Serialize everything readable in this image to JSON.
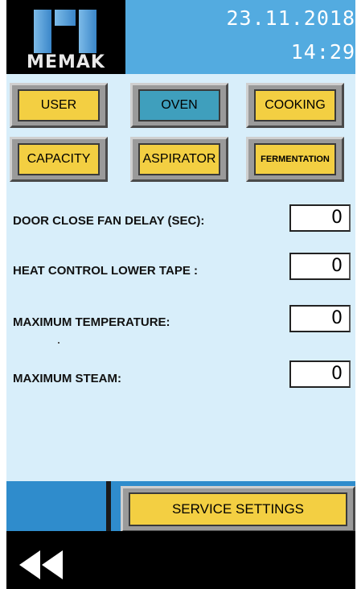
{
  "header": {
    "logo_text": "MEMAK",
    "date": "23.11.2018",
    "time": "14:29"
  },
  "tabs": [
    {
      "label": "USER",
      "active": false
    },
    {
      "label": "OVEN",
      "active": true
    },
    {
      "label": "COOKING",
      "active": false
    },
    {
      "label": "CAPACITY",
      "active": false
    },
    {
      "label": "ASPIRATOR",
      "active": false
    },
    {
      "label": "FERMENTATION",
      "active": false
    }
  ],
  "parameters": [
    {
      "label": "DOOR CLOSE FAN DELAY (SEC):",
      "value": "0"
    },
    {
      "label": "HEAT CONTROL LOWER TAPE :",
      "value": "0"
    },
    {
      "label": "MAXIMUM TEMPERATURE:",
      "value": "0"
    },
    {
      "label": "MAXIMUM STEAM:",
      "value": "0"
    }
  ],
  "footer": {
    "service_label": "SERVICE SETTINGS",
    "back_icon": "rewind-icon"
  },
  "colors": {
    "background": "#d8eefa",
    "header_blue": "#53abe0",
    "button_yellow": "#f3cf42",
    "button_active": "#3f9fbd",
    "footer_black": "#000000"
  }
}
